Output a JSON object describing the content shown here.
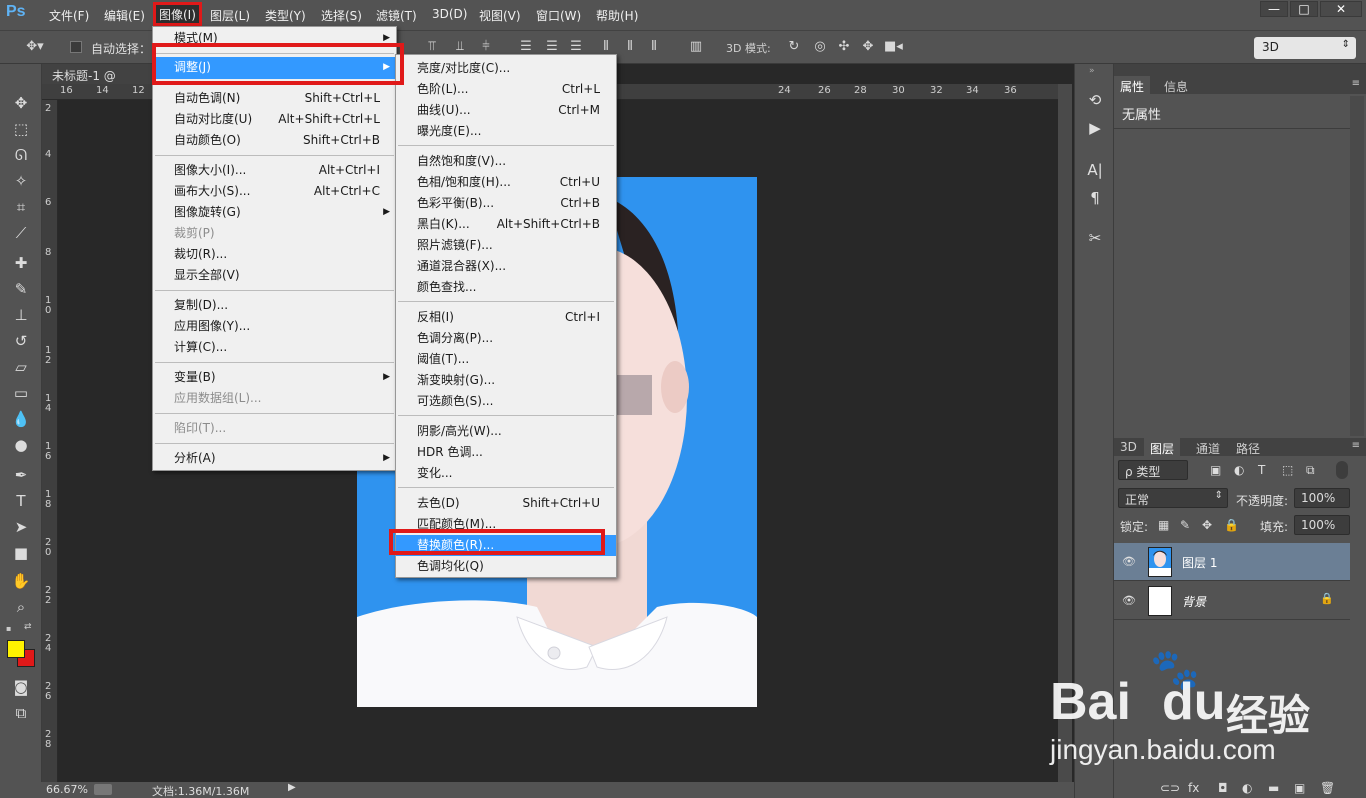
{
  "menubar": {
    "logo": "Ps",
    "items": [
      "文件(F)",
      "编辑(E)",
      "图像(I)",
      "图层(L)",
      "类型(Y)",
      "选择(S)",
      "滤镜(T)",
      "3D(D)",
      "视图(V)",
      "窗口(W)",
      "帮助(H)"
    ],
    "active_item": "图像(I)",
    "window_buttons": [
      "—",
      "□",
      "✕"
    ]
  },
  "options_bar": {
    "auto_select_label": "自动选择：",
    "mode3d_label": "3D 模式:",
    "workspace_select": "3D"
  },
  "document": {
    "tab_title": "未标题-1 @ 66.7",
    "hruler_ticks": [
      "16",
      "14",
      "12",
      "24",
      "26",
      "28",
      "30",
      "32",
      "34",
      "36"
    ],
    "vruler_ticks": [
      "2",
      "4",
      "6",
      "8",
      "1 0",
      "1 2",
      "1 4",
      "1 6",
      "1 8",
      "2 0",
      "2 2",
      "2 4",
      "2 6",
      "2 8"
    ]
  },
  "status": {
    "zoom": "66.67%",
    "doc_info": "文档:1.36M/1.36M"
  },
  "image_menu": {
    "items": [
      {
        "label": "模式(M)",
        "shortcut": "",
        "submenu": true
      },
      {
        "label": "调整(J)",
        "shortcut": "",
        "submenu": true,
        "highlight": true
      },
      {
        "label": "自动色调(N)",
        "shortcut": "Shift+Ctrl+L"
      },
      {
        "label": "自动对比度(U)",
        "shortcut": "Alt+Shift+Ctrl+L"
      },
      {
        "label": "自动颜色(O)",
        "shortcut": "Shift+Ctrl+B"
      },
      {
        "label": "图像大小(I)...",
        "shortcut": "Alt+Ctrl+I"
      },
      {
        "label": "画布大小(S)...",
        "shortcut": "Alt+Ctrl+C"
      },
      {
        "label": "图像旋转(G)",
        "shortcut": "",
        "submenu": true
      },
      {
        "label": "裁剪(P)",
        "shortcut": "",
        "disabled": true
      },
      {
        "label": "裁切(R)...",
        "shortcut": ""
      },
      {
        "label": "显示全部(V)",
        "shortcut": ""
      },
      {
        "label": "复制(D)...",
        "shortcut": ""
      },
      {
        "label": "应用图像(Y)...",
        "shortcut": ""
      },
      {
        "label": "计算(C)...",
        "shortcut": ""
      },
      {
        "label": "变量(B)",
        "shortcut": "",
        "submenu": true
      },
      {
        "label": "应用数据组(L)...",
        "shortcut": "",
        "disabled": true
      },
      {
        "label": "陷印(T)...",
        "shortcut": "",
        "disabled": true
      },
      {
        "label": "分析(A)",
        "shortcut": "",
        "submenu": true
      }
    ]
  },
  "adjust_menu": {
    "items": [
      {
        "label": "亮度/对比度(C)...",
        "shortcut": ""
      },
      {
        "label": "色阶(L)...",
        "shortcut": "Ctrl+L"
      },
      {
        "label": "曲线(U)...",
        "shortcut": "Ctrl+M"
      },
      {
        "label": "曝光度(E)...",
        "shortcut": ""
      },
      {
        "label": "自然饱和度(V)...",
        "shortcut": ""
      },
      {
        "label": "色相/饱和度(H)...",
        "shortcut": "Ctrl+U"
      },
      {
        "label": "色彩平衡(B)...",
        "shortcut": "Ctrl+B"
      },
      {
        "label": "黑白(K)...",
        "shortcut": "Alt+Shift+Ctrl+B"
      },
      {
        "label": "照片滤镜(F)...",
        "shortcut": ""
      },
      {
        "label": "通道混合器(X)...",
        "shortcut": ""
      },
      {
        "label": "颜色查找...",
        "shortcut": ""
      },
      {
        "label": "反相(I)",
        "shortcut": "Ctrl+I"
      },
      {
        "label": "色调分离(P)...",
        "shortcut": ""
      },
      {
        "label": "阈值(T)...",
        "shortcut": ""
      },
      {
        "label": "渐变映射(G)...",
        "shortcut": ""
      },
      {
        "label": "可选颜色(S)...",
        "shortcut": ""
      },
      {
        "label": "阴影/高光(W)...",
        "shortcut": ""
      },
      {
        "label": "HDR 色调...",
        "shortcut": ""
      },
      {
        "label": "变化...",
        "shortcut": ""
      },
      {
        "label": "去色(D)",
        "shortcut": "Shift+Ctrl+U"
      },
      {
        "label": "匹配颜色(M)...",
        "shortcut": ""
      },
      {
        "label": "替换颜色(R)...",
        "shortcut": "",
        "highlight": true
      },
      {
        "label": "色调均化(Q)",
        "shortcut": ""
      }
    ]
  },
  "properties_panel": {
    "tabs": [
      "属性",
      "信息"
    ],
    "body_text": "无属性"
  },
  "layers_panel": {
    "tabs": [
      "3D",
      "图层",
      "通道",
      "路径"
    ],
    "filter_label": "ρ 类型",
    "blend_mode": "正常",
    "opacity_label": "不透明度:",
    "opacity_value": "100%",
    "lock_label": "锁定:",
    "fill_label": "填充:",
    "fill_value": "100%",
    "layers": [
      {
        "name": "图层 1",
        "selected": true
      },
      {
        "name": "背景",
        "selected": false
      }
    ]
  },
  "watermark": {
    "brand": "Bai",
    "brand2": "du",
    "suffix": "经验",
    "url": "jingyan.baidu.com"
  },
  "colors": {
    "foreground": "#fff200",
    "background": "#e01919",
    "photo_bg": "#2f93ef",
    "highlight": "#3399ff",
    "annotation": "#e01919"
  }
}
